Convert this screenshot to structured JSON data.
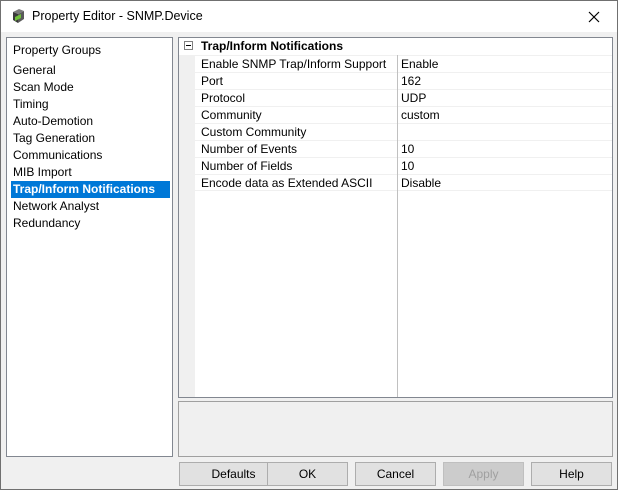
{
  "window": {
    "title": "Property Editor - SNMP.Device",
    "icons": {
      "app": "property-editor-icon",
      "close": "close-icon"
    }
  },
  "groups": {
    "header": "Property Groups",
    "items": [
      "General",
      "Scan Mode",
      "Timing",
      "Auto-Demotion",
      "Tag Generation",
      "Communications",
      "MIB Import",
      "Trap/Inform Notifications",
      "Network Analyst",
      "Redundancy"
    ],
    "selected_index": 7
  },
  "grid": {
    "category": "Trap/Inform Notifications",
    "category_state": "expanded",
    "rows": [
      {
        "name": "Enable SNMP Trap/Inform Support",
        "value": "Enable"
      },
      {
        "name": "Port",
        "value": "162"
      },
      {
        "name": "Protocol",
        "value": "UDP"
      },
      {
        "name": "Community",
        "value": "custom"
      },
      {
        "name": "Custom Community",
        "value": ""
      },
      {
        "name": "Number of Events",
        "value": "10"
      },
      {
        "name": "Number of Fields",
        "value": "10"
      },
      {
        "name": "Encode data as Extended ASCII",
        "value": "Disable"
      }
    ]
  },
  "buttons": {
    "defaults": "Defaults",
    "ok": "OK",
    "cancel": "Cancel",
    "apply": "Apply",
    "help": "Help"
  },
  "colors": {
    "selection": "#0078d7",
    "grid_line": "#f0f0f0",
    "disabled_text": "#a0a0a0"
  }
}
